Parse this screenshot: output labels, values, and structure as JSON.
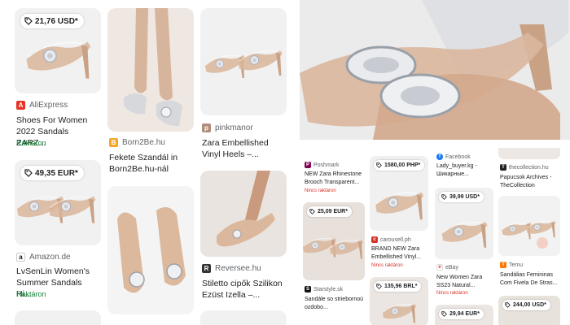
{
  "left": {
    "col1": [
      {
        "price": "21,76 USD*",
        "source": "AliExpress",
        "title": "Shoes For Women 2022 Sandals ZARZ...",
        "stock": "Raktáron"
      },
      {
        "price": "49,35 EUR*",
        "source": "Amazon.de",
        "title": "LvSenLin Women's Summer Sandals Hi...",
        "stock": "Raktáron"
      }
    ],
    "col2": [
      {
        "source": "Born2Be.hu",
        "title": "Fekete Szandál in Born2Be.hu-nál"
      }
    ],
    "col3": [
      {
        "source": "pinkmanor",
        "title": "Zara Embellished Vinyl Heels –..."
      },
      {
        "source": "Reversee.hu",
        "title": "Stiletto cipők Szilikon Ezüst Izella –..."
      }
    ]
  },
  "right": {
    "col1": [
      {
        "source": "Poshmark",
        "title": "NEW Zara Rhinestone Brooch Transparent...",
        "stock": "Nincs raktáron"
      },
      {
        "price": "25,09 EUR*",
        "source": "Starstyle.sk",
        "title": "Sandále so striebornoú ozdobo..."
      }
    ],
    "col2": [
      {
        "price": "1580,00 PHP*",
        "source": "carousell.ph",
        "title": "BRAND NEW Zara Embellished Vinyl...",
        "stock": "Nincs raktáron"
      },
      {
        "price": "135,96 BRL*"
      }
    ],
    "col3": [
      {
        "source": "Facebook",
        "title": "Lady_buyer.kg - Шикарные..."
      },
      {
        "price": "39,99 USD*",
        "source": "eBay",
        "title": "New Women Zara SS23 Natural...",
        "stock": "Nincs raktáron"
      },
      {
        "price": "29,94 EUR*"
      }
    ],
    "col4": [
      {
        "source": "thecollection.hu",
        "title": "Papucsok Archives - TheCollection"
      },
      {
        "source": "Temu",
        "title": "Sandálias Femininas Com Fivela De Stras..."
      },
      {
        "price": "244,00 USD*"
      }
    ]
  },
  "colors": {
    "nude": "#d9b59a",
    "silver": "#c8ccd2",
    "bg": "#f1f1f1",
    "green": "#188038",
    "red": "#d93025"
  },
  "icons": [
    "price-tag-icon",
    "aliexpress-icon",
    "amazon-icon",
    "born2be-icon",
    "pinkmanor-icon",
    "reversee-icon",
    "poshmark-icon",
    "starstyle-icon",
    "carousell-icon",
    "facebook-icon",
    "ebay-icon",
    "thecollection-icon",
    "temu-icon"
  ]
}
